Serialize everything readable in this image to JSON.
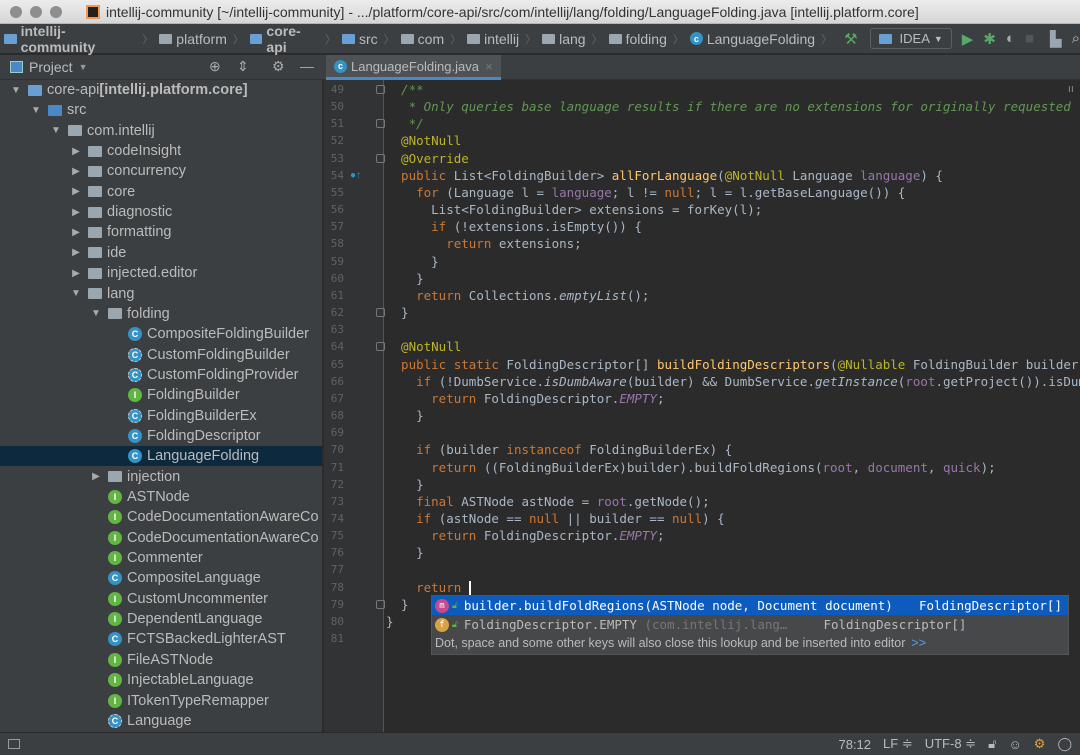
{
  "window": {
    "title": "intellij-community [~/intellij-community] - .../platform/core-api/src/com/intellij/lang/folding/LanguageFolding.java [intellij.platform.core]"
  },
  "navbar": {
    "crumbs": [
      "intellij-community",
      "platform",
      "core-api",
      "src",
      "com",
      "intellij",
      "lang",
      "folding",
      "LanguageFolding"
    ],
    "run_config": "IDEA"
  },
  "project_panel": {
    "title": "Project"
  },
  "editor_tab": {
    "label": "LanguageFolding.java"
  },
  "tree": [
    {
      "label": "core-api",
      "suffix": " [intellij.platform.core]",
      "level": 0,
      "type": "mod",
      "expanded": true
    },
    {
      "label": "src",
      "level": 1,
      "type": "src",
      "expanded": true
    },
    {
      "label": "com.intellij",
      "level": 2,
      "type": "pkg",
      "expanded": true
    },
    {
      "label": "codeInsight",
      "level": 3,
      "type": "pkg",
      "expanded": false
    },
    {
      "label": "concurrency",
      "level": 3,
      "type": "pkg",
      "expanded": false
    },
    {
      "label": "core",
      "level": 3,
      "type": "pkg",
      "expanded": false
    },
    {
      "label": "diagnostic",
      "level": 3,
      "type": "pkg",
      "expanded": false
    },
    {
      "label": "formatting",
      "level": 3,
      "type": "pkg",
      "expanded": false
    },
    {
      "label": "ide",
      "level": 3,
      "type": "pkg",
      "expanded": false
    },
    {
      "label": "injected.editor",
      "level": 3,
      "type": "pkg",
      "expanded": false
    },
    {
      "label": "lang",
      "level": 3,
      "type": "pkg",
      "expanded": true
    },
    {
      "label": "folding",
      "level": 4,
      "type": "pkg",
      "expanded": true
    },
    {
      "label": "CompositeFoldingBuilder",
      "level": 5,
      "type": "c"
    },
    {
      "label": "CustomFoldingBuilder",
      "level": 5,
      "type": "ac"
    },
    {
      "label": "CustomFoldingProvider",
      "level": 5,
      "type": "ac"
    },
    {
      "label": "FoldingBuilder",
      "level": 5,
      "type": "i"
    },
    {
      "label": "FoldingBuilderEx",
      "level": 5,
      "type": "ac"
    },
    {
      "label": "FoldingDescriptor",
      "level": 5,
      "type": "c"
    },
    {
      "label": "LanguageFolding",
      "level": 5,
      "type": "c",
      "selected": true
    },
    {
      "label": "injection",
      "level": 4,
      "type": "pkg",
      "expanded": false
    },
    {
      "label": "ASTNode",
      "level": 4,
      "type": "i"
    },
    {
      "label": "CodeDocumentationAwareCo",
      "level": 4,
      "type": "i"
    },
    {
      "label": "CodeDocumentationAwareCo",
      "level": 4,
      "type": "i"
    },
    {
      "label": "Commenter",
      "level": 4,
      "type": "i"
    },
    {
      "label": "CompositeLanguage",
      "level": 4,
      "type": "c"
    },
    {
      "label": "CustomUncommenter",
      "level": 4,
      "type": "i"
    },
    {
      "label": "DependentLanguage",
      "level": 4,
      "type": "i"
    },
    {
      "label": "FCTSBackedLighterAST",
      "level": 4,
      "type": "c"
    },
    {
      "label": "FileASTNode",
      "level": 4,
      "type": "i"
    },
    {
      "label": "InjectableLanguage",
      "level": 4,
      "type": "i"
    },
    {
      "label": "ITokenTypeRemapper",
      "level": 4,
      "type": "i"
    },
    {
      "label": "Language",
      "level": 4,
      "type": "ac"
    }
  ],
  "code": {
    "first_line": 49,
    "lines": [
      [
        [
          "  /**",
          "doc"
        ]
      ],
      [
        [
          "   * Only queries base language results if there are no extensions for originally requested",
          "doc"
        ]
      ],
      [
        [
          "   */",
          "doc"
        ]
      ],
      [
        [
          "  @NotNull",
          "ann"
        ]
      ],
      [
        [
          "  @Override",
          "ann"
        ]
      ],
      [
        [
          "  public ",
          "kw"
        ],
        [
          "List<FoldingBuilder> ",
          ""
        ],
        [
          "allForLanguage",
          "fn"
        ],
        [
          "(",
          ""
        ],
        [
          "@NotNull ",
          "ann"
        ],
        [
          "Language ",
          ""
        ],
        [
          "language",
          "pm"
        ],
        [
          ") {",
          ""
        ]
      ],
      [
        [
          "    for ",
          "kw"
        ],
        [
          "(Language l = ",
          ""
        ],
        [
          "language",
          "pm"
        ],
        [
          "; l != ",
          ""
        ],
        [
          "null",
          "kw"
        ],
        [
          "; l = l.getBaseLanguage()) {",
          ""
        ]
      ],
      [
        [
          "      List<FoldingBuilder> extensions = forKey(l);",
          ""
        ]
      ],
      [
        [
          "      if ",
          "kw"
        ],
        [
          "(!extensions.isEmpty()) {",
          ""
        ]
      ],
      [
        [
          "        return ",
          "kw"
        ],
        [
          "extensions;",
          ""
        ]
      ],
      [
        [
          "      }",
          ""
        ]
      ],
      [
        [
          "    }",
          ""
        ]
      ],
      [
        [
          "    return ",
          "kw"
        ],
        [
          "Collections.",
          ""
        ],
        [
          "emptyList",
          "st"
        ],
        [
          "();",
          ""
        ]
      ],
      [
        [
          "  }",
          ""
        ]
      ],
      [],
      [
        [
          "  @NotNull",
          "ann"
        ]
      ],
      [
        [
          "  public static ",
          "kw"
        ],
        [
          "FoldingDescriptor[] ",
          ""
        ],
        [
          "buildFoldingDescriptors",
          "fn"
        ],
        [
          "(",
          ""
        ],
        [
          "@Nullable ",
          "ann"
        ],
        [
          "FoldingBuilder builder,",
          ""
        ]
      ],
      [
        [
          "    if ",
          "kw"
        ],
        [
          "(!DumbService.",
          ""
        ],
        [
          "isDumbAware",
          "st"
        ],
        [
          "(builder) && DumbService.",
          ""
        ],
        [
          "getInstance",
          "st"
        ],
        [
          "(",
          ""
        ],
        [
          "root",
          "pm"
        ],
        [
          ".getProject()).isDum",
          ""
        ]
      ],
      [
        [
          "      return ",
          "kw"
        ],
        [
          "FoldingDescriptor.",
          ""
        ],
        [
          "EMPTY",
          "sf"
        ],
        [
          ";",
          ""
        ]
      ],
      [
        [
          "    }",
          ""
        ]
      ],
      [],
      [
        [
          "    if ",
          "kw"
        ],
        [
          "(builder ",
          ""
        ],
        [
          "instanceof ",
          "kw"
        ],
        [
          "FoldingBuilderEx) {",
          ""
        ]
      ],
      [
        [
          "      return ",
          "kw"
        ],
        [
          "((FoldingBuilderEx)builder).buildFoldRegions(",
          ""
        ],
        [
          "root",
          "pm"
        ],
        [
          ", ",
          ""
        ],
        [
          "document",
          "pm"
        ],
        [
          ", ",
          ""
        ],
        [
          "quick",
          "pm"
        ],
        [
          ");",
          ""
        ]
      ],
      [
        [
          "    }",
          ""
        ]
      ],
      [
        [
          "    final ",
          "kw"
        ],
        [
          "ASTNode astNode = ",
          ""
        ],
        [
          "root",
          "pm"
        ],
        [
          ".getNode();",
          ""
        ]
      ],
      [
        [
          "    if ",
          "kw"
        ],
        [
          "(astNode == ",
          ""
        ],
        [
          "null ",
          "kw"
        ],
        [
          "|| builder == ",
          ""
        ],
        [
          "null",
          "kw"
        ],
        [
          ") {",
          ""
        ]
      ],
      [
        [
          "      return ",
          "kw"
        ],
        [
          "FoldingDescriptor.",
          ""
        ],
        [
          "EMPTY",
          "sf"
        ],
        [
          ";",
          ""
        ]
      ],
      [
        [
          "    }",
          ""
        ]
      ],
      [],
      [
        [
          "    return ",
          "kw"
        ]
      ],
      [
        [
          "  }",
          ""
        ]
      ],
      [
        [
          "}",
          ""
        ]
      ],
      []
    ]
  },
  "completion": {
    "items": [
      {
        "icon": "m",
        "text": "builder.buildFoldRegions(ASTNode node, Document document)",
        "detail": "",
        "type": "FoldingDescriptor[]",
        "selected": true
      },
      {
        "icon": "f",
        "text": "FoldingDescriptor.EMPTY",
        "detail": " (com.intellij.lang…",
        "type": "FoldingDescriptor[]"
      }
    ],
    "hint": "Dot, space and some other keys will also close this lookup and be inserted into editor",
    "hint_link": ">>"
  },
  "status": {
    "position": "78:12",
    "line_sep": "LF ≑",
    "encoding": "UTF-8 ≑"
  },
  "colors": {
    "accent": "#4a88c7",
    "selection": "#0d5bbd"
  }
}
